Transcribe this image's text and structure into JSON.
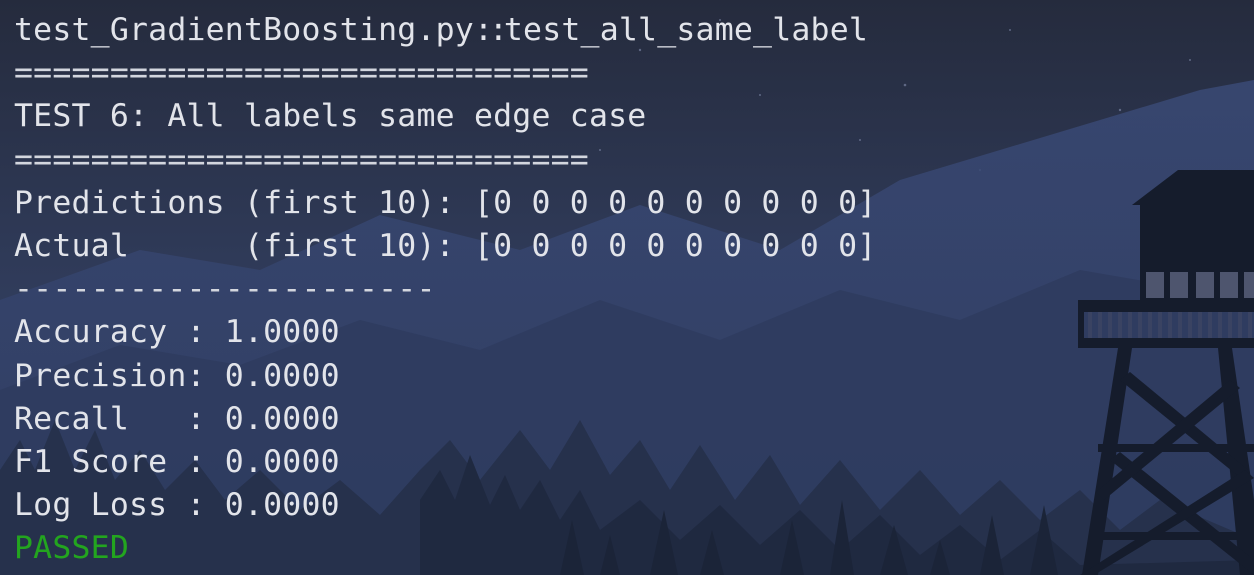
{
  "terminal": {
    "test_id_file": "test_GradientBoosting.py",
    "test_id_sep": "::",
    "test_id_func": "test_all_same_label",
    "rule_double_1": "==============================",
    "test_header": "TEST 6: All labels same edge case",
    "rule_double_2": "==============================",
    "predictions_line": "Predictions (first 10): [0 0 0 0 0 0 0 0 0 0]",
    "actual_line": "Actual      (first 10): [0 0 0 0 0 0 0 0 0 0]",
    "rule_single": "----------------------",
    "metrics": [
      "Accuracy : 1.0000",
      "Precision: 0.0000",
      "Recall   : 0.0000",
      "F1 Score : 0.0000",
      "Log Loss : 0.0000"
    ],
    "status": "PASSED"
  },
  "colors": {
    "text": "#e2e4ea",
    "passed": "#23a51f",
    "sky_top": "#262c3f",
    "sky_bottom": "#3c4a72",
    "tower_silhouette": "#161d2e"
  }
}
